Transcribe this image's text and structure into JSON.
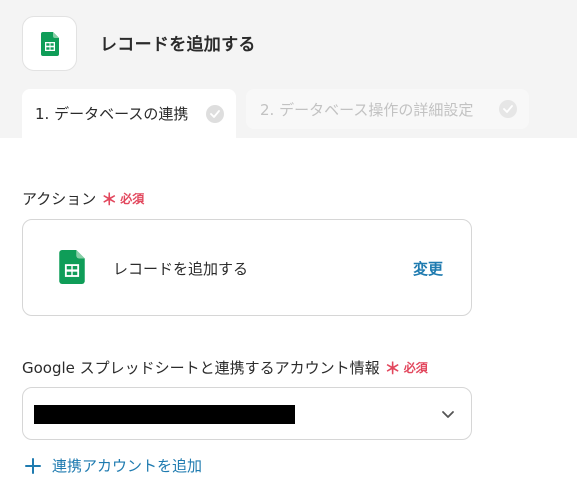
{
  "header": {
    "title": "レコードを追加する",
    "app_icon": "google-sheets-icon"
  },
  "tabs": [
    {
      "label": "1. データベースの連携",
      "active": true
    },
    {
      "label": "2. データベース操作の詳細設定",
      "active": false
    }
  ],
  "action_field": {
    "label": "アクション",
    "required_mark": "＊",
    "required_text": "必須",
    "value": "レコードを追加する",
    "change_label": "変更"
  },
  "account_field": {
    "label": "Google スプレッドシートと連携するアカウント情報",
    "required_mark": "＊",
    "required_text": "必須",
    "value_redacted": true
  },
  "add_account_label": "連携アカウントを追加",
  "colors": {
    "accent": "#1f7bb0",
    "required": "#e2475d",
    "sheets_green": "#0f9d58"
  }
}
